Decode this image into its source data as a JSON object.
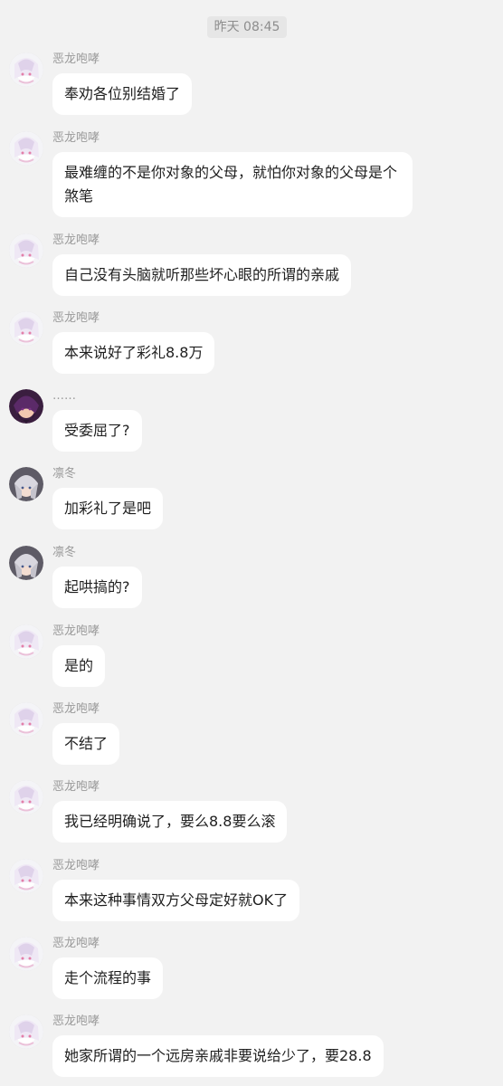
{
  "chat": {
    "timestamp": "昨天 08:45",
    "messages": [
      {
        "sender": "恶龙咆哮",
        "avatar": "white-hair-anime-avatar",
        "text": "奉劝各位别结婚了"
      },
      {
        "sender": "恶龙咆哮",
        "avatar": "white-hair-anime-avatar",
        "text": "最难缠的不是你对象的父母，就怕你对象的父母是个煞笔"
      },
      {
        "sender": "恶龙咆哮",
        "avatar": "white-hair-anime-avatar",
        "text": "自己没有头脑就听那些坏心眼的所谓的亲戚"
      },
      {
        "sender": "恶龙咆哮",
        "avatar": "white-hair-anime-avatar",
        "text": "本来说好了彩礼8.8万"
      },
      {
        "sender": "……",
        "avatar": "purple-dark-hair-avatar",
        "text": "受委屈了?"
      },
      {
        "sender": "凛冬",
        "avatar": "gray-hair-girl-avatar",
        "text": "加彩礼了是吧"
      },
      {
        "sender": "凛冬",
        "avatar": "gray-hair-girl-avatar",
        "text": "起哄搞的?"
      },
      {
        "sender": "恶龙咆哮",
        "avatar": "white-hair-anime-avatar",
        "text": "是的"
      },
      {
        "sender": "恶龙咆哮",
        "avatar": "white-hair-anime-avatar",
        "text": "不结了"
      },
      {
        "sender": "恶龙咆哮",
        "avatar": "white-hair-anime-avatar",
        "text": "我已经明确说了，要么8.8要么滚"
      },
      {
        "sender": "恶龙咆哮",
        "avatar": "white-hair-anime-avatar",
        "text": "本来这种事情双方父母定好就OK了"
      },
      {
        "sender": "恶龙咆哮",
        "avatar": "white-hair-anime-avatar",
        "text": "走个流程的事"
      },
      {
        "sender": "恶龙咆哮",
        "avatar": "white-hair-anime-avatar",
        "text": "她家所谓的一个远房亲戚非要说给少了，要28.8"
      }
    ]
  }
}
